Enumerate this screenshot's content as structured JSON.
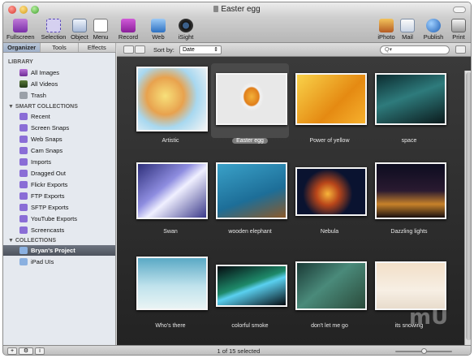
{
  "window": {
    "title": "Easter egg"
  },
  "toolbar": {
    "fullscreen": "Fullscreen",
    "selection": "Selection",
    "object": "Object",
    "menu": "Menu",
    "record": "Record",
    "web": "Web",
    "isight": "iSight",
    "iphoto": "iPhoto",
    "mail": "Mail",
    "publish": "Publish",
    "print": "Print"
  },
  "panes": {
    "tabs": [
      "Organizer",
      "Tools",
      "Effects"
    ]
  },
  "sidebar": {
    "library_header": "LIBRARY",
    "library": [
      "All Images",
      "All Videos",
      "Trash"
    ],
    "smart_header": "SMART COLLECTIONS",
    "smart": [
      "Recent",
      "Screen Snaps",
      "Web Snaps",
      "Cam Snaps",
      "Imports",
      "Dragged Out",
      "Flickr Exports",
      "FTP Exports",
      "SFTP Exports",
      "YouTube Exports",
      "Screencasts"
    ],
    "collections_header": "COLLECTIONS",
    "collections": [
      "Bryan's Project",
      "iPad UIs"
    ]
  },
  "content": {
    "sort_label": "Sort by:",
    "sort_value": "Date",
    "search_placeholder": "Q▾",
    "items": [
      "Artistic",
      "Easter egg",
      "Power of yellow",
      "space",
      "Swan",
      "wooden elephant",
      "Nebula",
      "Dazzling lights",
      "Who's there",
      "colorful smoke",
      "don't let me go",
      "its snowing"
    ]
  },
  "status": {
    "text": "1 of 15 selected",
    "zoom": 0.5
  },
  "watermark": "mU",
  "colors": {
    "selection": "#4d535d",
    "grid_bg": "#2a2a2a",
    "sidebar_bg": "#e5e9ef"
  }
}
